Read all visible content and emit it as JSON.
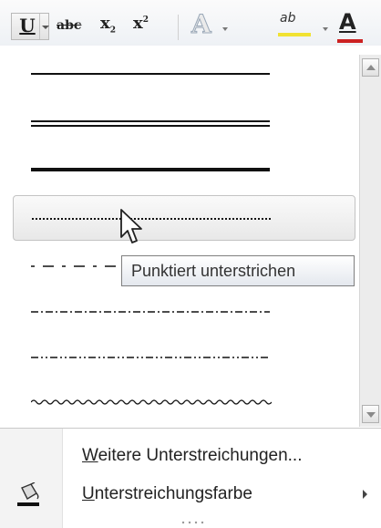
{
  "toolbar": {
    "underline_label": "U",
    "strikethrough_label": "abc",
    "subscript_base": "x",
    "subscript_mark": "2",
    "superscript_base": "x",
    "superscript_mark": "2",
    "text_effect_label": "A",
    "highlight_label": "ab",
    "font_color_label": "A"
  },
  "gallery": {
    "styles": [
      "single",
      "double",
      "thick",
      "dotted",
      "dashed",
      "dash-dot",
      "dash-dot-dot",
      "wave"
    ],
    "hovered_style": "dotted"
  },
  "tooltip": {
    "text": "Punktiert unterstrichen"
  },
  "menu": {
    "more_underlines": {
      "accel": "W",
      "rest": "eitere Unterstreichungen..."
    },
    "underline_color": {
      "accel": "U",
      "rest": "nterstreichungsfarbe"
    }
  },
  "colors": {
    "highlight_bar": "#f1e232",
    "font_color_bar": "#cc2222",
    "line": "#111111"
  }
}
